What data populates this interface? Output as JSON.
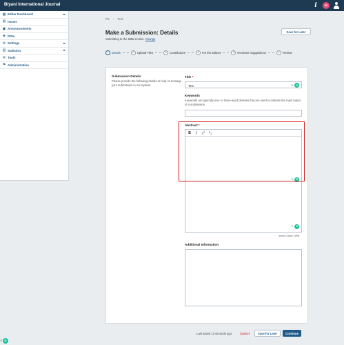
{
  "app": {
    "title": "Biyani International Journal"
  },
  "topbar": {
    "info_icon": "i",
    "notifications_count": "85"
  },
  "sidebar": {
    "items": [
      {
        "label": "Editor Dashboard",
        "icon": "dashboard-icon",
        "glyph": "▦",
        "has_caret": true
      },
      {
        "label": "Issues",
        "icon": "issues-icon",
        "glyph": "▤",
        "has_caret": false
      },
      {
        "label": "Announcements",
        "icon": "announcements-icon",
        "glyph": "▣",
        "has_caret": false
      },
      {
        "label": "DOIs",
        "icon": "doi-icon",
        "glyph": "◈",
        "has_caret": false
      },
      {
        "label": "Settings",
        "icon": "gear-icon",
        "glyph": "⚙",
        "has_caret": true
      },
      {
        "label": "Statistics",
        "icon": "statistics-icon",
        "glyph": "▥",
        "has_caret": true
      },
      {
        "label": "Tools",
        "icon": "tools-icon",
        "glyph": "⚒",
        "has_caret": false
      },
      {
        "label": "Administration",
        "icon": "administration-icon",
        "glyph": "⚑",
        "has_caret": false
      }
    ]
  },
  "breadcrumb": {
    "item1": "PS",
    "sep": "›",
    "item2": "Test"
  },
  "page": {
    "title": "Make a Submission: Details",
    "subtitle_prefix": "Submitting to the ",
    "subtitle_section": "Arts",
    "subtitle_suffix": " section. ",
    "subtitle_link": "Change",
    "save_later": "Save for Later"
  },
  "steps": [
    {
      "num": "1",
      "label": "Details"
    },
    {
      "num": "2",
      "label": "Upload Files"
    },
    {
      "num": "3",
      "label": "Contributors"
    },
    {
      "num": "4",
      "label": "For the Editors"
    },
    {
      "num": "5",
      "label": "Reviewer Suggestions"
    },
    {
      "num": "6",
      "label": "Review"
    }
  ],
  "form": {
    "section_title": "Submission Details",
    "section_desc": "Please provide the following details to help us manage your submission in our system.",
    "title_label": "Title",
    "title_required": "*",
    "title_value": "Test",
    "keywords_label": "Keywords",
    "keywords_desc": "Keywords are typically one- to three-word phrases that are used to indicate the main topics of a submission.",
    "abstract_label": "Abstract",
    "abstract_required": "*",
    "toolbar": {
      "bold": "B",
      "italic": "I",
      "superscript": "x",
      "subscript": "x",
      "sup_mark": "2",
      "sub_mark": "2"
    },
    "word_count": "Word Count: 0/98",
    "additional_label": "Additional Information"
  },
  "footer": {
    "status": "Last saved 13 seconds ago",
    "cancel": "Cancel",
    "save_later": "Save for Later",
    "continue": "Continue"
  },
  "colors": {
    "topbar": "#1d3a52",
    "accent": "#1d5a8a",
    "danger": "#d00000",
    "grammarly": "#15c39a",
    "highlight": "#d11a1a"
  }
}
